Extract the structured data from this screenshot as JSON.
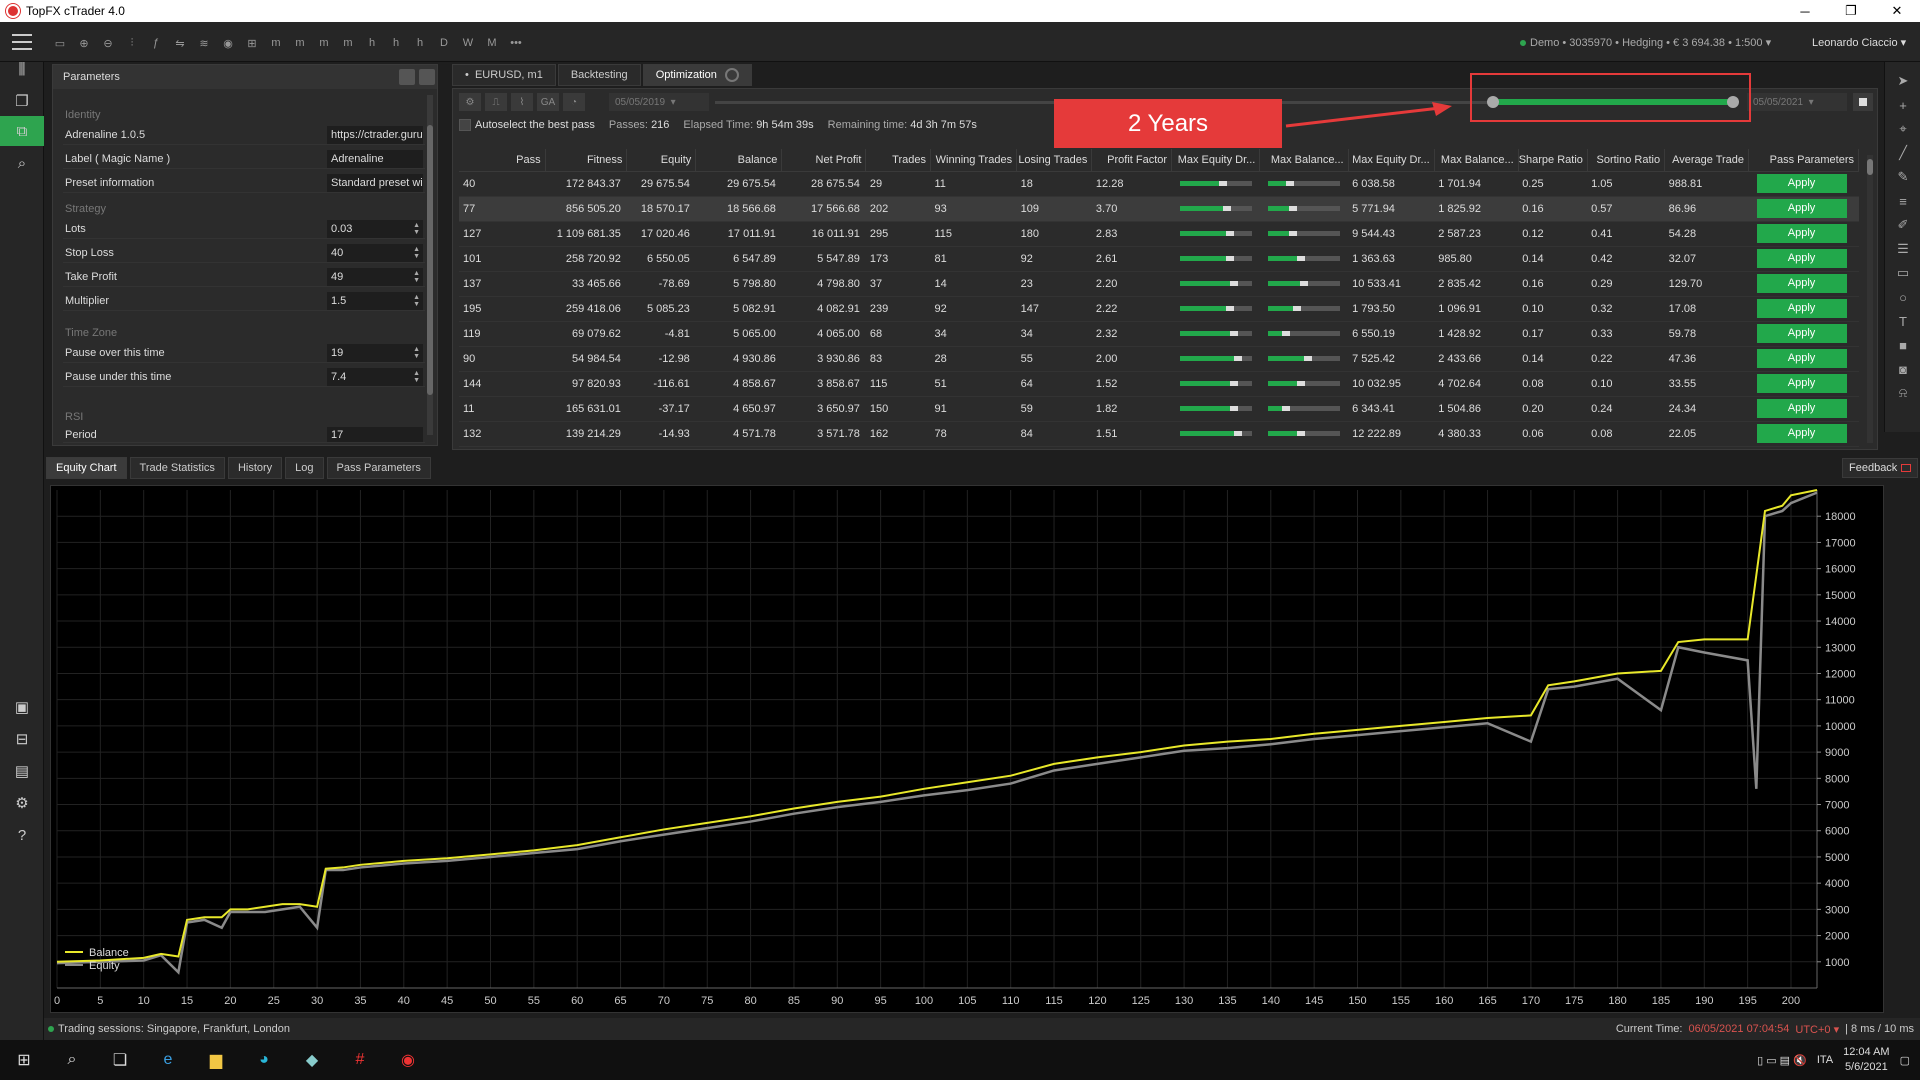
{
  "window": {
    "title": "TopFX cTrader 4.0",
    "min": "─",
    "max": "❐",
    "close": "✕"
  },
  "account": {
    "info": "Demo • 3035970 • Hedging • € 3 694.38 • 1:500",
    "user": "Leonardo Ciaccio"
  },
  "toolbar": {
    "timeframes": [
      "m",
      "m",
      "m",
      "m",
      "h",
      "h",
      "h",
      "D",
      "W",
      "M",
      "•••"
    ]
  },
  "params": {
    "title": "Parameters",
    "sections": {
      "identity": "Identity",
      "strategy": "Strategy",
      "timezone": "Time Zone",
      "rsi": "RSI"
    },
    "rows": [
      {
        "label": "Adrenaline 1.0.5",
        "value": "https://ctrader.guru"
      },
      {
        "label": "Label ( Magic Name )",
        "value": "Adrenaline"
      },
      {
        "label": "Preset information",
        "value": "Standard preset wi"
      },
      {
        "label": "Lots",
        "value": "0.03"
      },
      {
        "label": "Stop Loss",
        "value": "40"
      },
      {
        "label": "Take Profit",
        "value": "49"
      },
      {
        "label": "Multiplier",
        "value": "1.5"
      },
      {
        "label": "Pause over this time",
        "value": "19"
      },
      {
        "label": "Pause under this time",
        "value": "7.4"
      },
      {
        "label": "Period",
        "value": "17"
      }
    ]
  },
  "opt_tabs": {
    "symbol": "EURUSD, m1",
    "backtesting": "Backtesting",
    "optimization": "Optimization"
  },
  "opt": {
    "tool_labels": [
      "⚙",
      "⎍",
      "⌇",
      "GA",
      "◔"
    ],
    "start_date": "05/05/2019",
    "end_date": "05/05/2021",
    "autoselect": "Autoselect the best pass",
    "passes_label": "Passes:",
    "passes": "216",
    "elapsed_label": "Elapsed Time:",
    "elapsed": "9h 54m 39s",
    "remaining_label": "Remaining time:",
    "remaining": "4d 3h 7m 57s",
    "range_start": 0,
    "range_end": 1
  },
  "callout": {
    "text": "2 Years"
  },
  "table": {
    "columns": [
      "Pass",
      "Fitness",
      "Equity",
      "Balance",
      "Net Profit",
      "Trades",
      "Winning Trades",
      "Losing Trades",
      "Profit Factor",
      "Max Equity Dr...",
      "Max Balance...",
      "Max Equity Dr...",
      "Max Balance...",
      "Sharpe Ratio",
      "Sortino Ratio",
      "Average Trade",
      "Pass Parameters"
    ],
    "apply_label": "Apply",
    "rows": [
      {
        "pass": "40",
        "fitness": "172 843.37",
        "equity": "29 675.54",
        "balance": "29 675.54",
        "net": "28 675.54",
        "trades": "29",
        "win": "11",
        "lose": "18",
        "pf": "12.28",
        "med": 0.55,
        "mbd": 0.25,
        "medv": "6 038.58",
        "mbdv": "1 701.94",
        "sharpe": "0.25",
        "sortino": "1.05",
        "avg": "988.81"
      },
      {
        "pass": "77",
        "fitness": "856 505.20",
        "equity": "18 570.17",
        "balance": "18 566.68",
        "net": "17 566.68",
        "trades": "202",
        "win": "93",
        "lose": "109",
        "pf": "3.70",
        "med": 0.6,
        "mbd": 0.3,
        "medv": "5 771.94",
        "mbdv": "1 825.92",
        "sharpe": "0.16",
        "sortino": "0.57",
        "avg": "86.96"
      },
      {
        "pass": "127",
        "fitness": "1 109 681.35",
        "equity": "17 020.46",
        "balance": "17 011.91",
        "net": "16 011.91",
        "trades": "295",
        "win": "115",
        "lose": "180",
        "pf": "2.83",
        "med": 0.65,
        "mbd": 0.3,
        "medv": "9 544.43",
        "mbdv": "2 587.23",
        "sharpe": "0.12",
        "sortino": "0.41",
        "avg": "54.28"
      },
      {
        "pass": "101",
        "fitness": "258 720.92",
        "equity": "6 550.05",
        "balance": "6 547.89",
        "net": "5 547.89",
        "trades": "173",
        "win": "81",
        "lose": "92",
        "pf": "2.61",
        "med": 0.65,
        "mbd": 0.4,
        "medv": "1 363.63",
        "mbdv": "985.80",
        "sharpe": "0.14",
        "sortino": "0.42",
        "avg": "32.07"
      },
      {
        "pass": "137",
        "fitness": "33 465.66",
        "equity": "-78.69",
        "balance": "5 798.80",
        "net": "4 798.80",
        "trades": "37",
        "win": "14",
        "lose": "23",
        "pf": "2.20",
        "med": 0.7,
        "mbd": 0.45,
        "medv": "10 533.41",
        "mbdv": "2 835.42",
        "sharpe": "0.16",
        "sortino": "0.29",
        "avg": "129.70"
      },
      {
        "pass": "195",
        "fitness": "259 418.06",
        "equity": "5 085.23",
        "balance": "5 082.91",
        "net": "4 082.91",
        "trades": "239",
        "win": "92",
        "lose": "147",
        "pf": "2.22",
        "med": 0.65,
        "mbd": 0.35,
        "medv": "1 793.50",
        "mbdv": "1 096.91",
        "sharpe": "0.10",
        "sortino": "0.32",
        "avg": "17.08"
      },
      {
        "pass": "119",
        "fitness": "69 079.62",
        "equity": "-4.81",
        "balance": "5 065.00",
        "net": "4 065.00",
        "trades": "68",
        "win": "34",
        "lose": "34",
        "pf": "2.32",
        "med": 0.7,
        "mbd": 0.2,
        "medv": "6 550.19",
        "mbdv": "1 428.92",
        "sharpe": "0.17",
        "sortino": "0.33",
        "avg": "59.78"
      },
      {
        "pass": "90",
        "fitness": "54 984.54",
        "equity": "-12.98",
        "balance": "4 930.86",
        "net": "3 930.86",
        "trades": "83",
        "win": "28",
        "lose": "55",
        "pf": "2.00",
        "med": 0.75,
        "mbd": 0.5,
        "medv": "7 525.42",
        "mbdv": "2 433.66",
        "sharpe": "0.14",
        "sortino": "0.22",
        "avg": "47.36"
      },
      {
        "pass": "144",
        "fitness": "97 820.93",
        "equity": "-116.61",
        "balance": "4 858.67",
        "net": "3 858.67",
        "trades": "115",
        "win": "51",
        "lose": "64",
        "pf": "1.52",
        "med": 0.7,
        "mbd": 0.4,
        "medv": "10 032.95",
        "mbdv": "4 702.64",
        "sharpe": "0.08",
        "sortino": "0.10",
        "avg": "33.55"
      },
      {
        "pass": "11",
        "fitness": "165 631.01",
        "equity": "-37.17",
        "balance": "4 650.97",
        "net": "3 650.97",
        "trades": "150",
        "win": "91",
        "lose": "59",
        "pf": "1.82",
        "med": 0.7,
        "mbd": 0.2,
        "medv": "6 343.41",
        "mbdv": "1 504.86",
        "sharpe": "0.20",
        "sortino": "0.24",
        "avg": "24.34"
      },
      {
        "pass": "132",
        "fitness": "139 214.29",
        "equity": "-14.93",
        "balance": "4 571.78",
        "net": "3 571.78",
        "trades": "162",
        "win": "78",
        "lose": "84",
        "pf": "1.51",
        "med": 0.75,
        "mbd": 0.4,
        "medv": "12 222.89",
        "mbdv": "4 380.33",
        "sharpe": "0.06",
        "sortino": "0.08",
        "avg": "22.05"
      }
    ]
  },
  "bottom_tabs": [
    "Equity Chart",
    "Trade Statistics",
    "History",
    "Log",
    "Pass Parameters"
  ],
  "feedback": "Feedback",
  "chart_data": {
    "type": "line",
    "xlim": [
      0,
      203
    ],
    "ylim": [
      0,
      19000
    ],
    "xticks": [
      0,
      5,
      10,
      15,
      20,
      25,
      30,
      35,
      40,
      45,
      50,
      55,
      60,
      65,
      70,
      75,
      80,
      85,
      90,
      95,
      100,
      105,
      110,
      115,
      120,
      125,
      130,
      135,
      140,
      145,
      150,
      155,
      160,
      165,
      170,
      175,
      180,
      185,
      190,
      195,
      200
    ],
    "yticks": [
      1000,
      2000,
      3000,
      4000,
      5000,
      6000,
      7000,
      8000,
      9000,
      10000,
      11000,
      12000,
      13000,
      14000,
      15000,
      16000,
      17000,
      18000
    ],
    "series": [
      {
        "name": "Balance",
        "color": "#e8e82a",
        "x": [
          0,
          5,
          10,
          12,
          14,
          15,
          17,
          19,
          20,
          22,
          24,
          26,
          28,
          30,
          31,
          33,
          35,
          40,
          45,
          50,
          55,
          60,
          65,
          70,
          75,
          80,
          85,
          90,
          95,
          100,
          105,
          110,
          115,
          120,
          125,
          130,
          135,
          140,
          145,
          150,
          155,
          160,
          165,
          170,
          172,
          175,
          180,
          185,
          187,
          190,
          195,
          197,
          199,
          200,
          203
        ],
        "y": [
          1000,
          1050,
          1150,
          1300,
          1200,
          2600,
          2700,
          2700,
          3000,
          3000,
          3100,
          3200,
          3200,
          3100,
          4550,
          4600,
          4700,
          4850,
          4950,
          5100,
          5250,
          5450,
          5750,
          6050,
          6300,
          6550,
          6850,
          7100,
          7300,
          7600,
          7850,
          8100,
          8550,
          8800,
          9000,
          9250,
          9400,
          9500,
          9700,
          9850,
          10000,
          10150,
          10300,
          10400,
          11550,
          11700,
          12000,
          12100,
          13200,
          13300,
          13300,
          18200,
          18400,
          18800,
          19000
        ]
      },
      {
        "name": "Equity",
        "color": "#8a8a8a",
        "x": [
          0,
          5,
          10,
          12,
          14,
          15,
          17,
          19,
          20,
          22,
          24,
          26,
          28,
          30,
          31,
          33,
          35,
          40,
          45,
          50,
          55,
          60,
          65,
          70,
          75,
          80,
          85,
          90,
          95,
          100,
          105,
          110,
          115,
          120,
          125,
          130,
          135,
          140,
          145,
          150,
          155,
          160,
          165,
          170,
          172,
          175,
          180,
          185,
          187,
          190,
          195,
          196,
          197,
          199,
          200,
          203
        ],
        "y": [
          950,
          1000,
          1050,
          1250,
          600,
          2500,
          2600,
          2300,
          2900,
          2900,
          2900,
          3000,
          3100,
          2300,
          4500,
          4500,
          4600,
          4750,
          4850,
          5000,
          5150,
          5300,
          5600,
          5850,
          6100,
          6350,
          6650,
          6900,
          7100,
          7350,
          7550,
          7800,
          8300,
          8550,
          8800,
          9050,
          9150,
          9300,
          9500,
          9650,
          9800,
          9950,
          10100,
          9400,
          11400,
          11500,
          11800,
          10600,
          13000,
          12800,
          12500,
          7600,
          18000,
          18200,
          18500,
          18900
        ]
      }
    ],
    "legend": "bottom-left"
  },
  "statusbar": {
    "sessions": "Trading sessions: Singapore, Frankfurt, London",
    "current_label": "Current Time:",
    "current": "06/05/2021 07:04:54",
    "utc": "UTC+0 ▾",
    "latency": "| 8 ms / 10 ms"
  },
  "taskbar": {
    "lang": "ITA",
    "time": "12:04 AM",
    "date": "5/6/2021"
  }
}
